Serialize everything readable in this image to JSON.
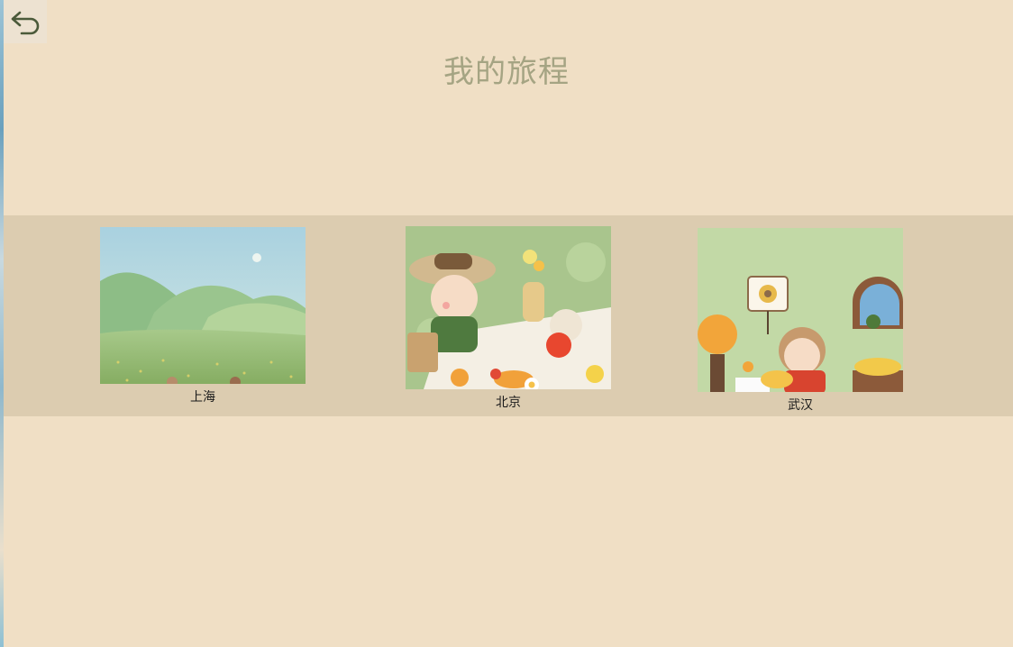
{
  "header": {
    "title": "我的旅程",
    "back_icon": "back-arrow-icon"
  },
  "trips": [
    {
      "city": "上海",
      "scene": "green-hills-meadow"
    },
    {
      "city": "北京",
      "scene": "picnic-bears"
    },
    {
      "city": "武汉",
      "scene": "cozy-room-child"
    }
  ],
  "colors": {
    "page_bg": "#f0dfc5",
    "band_bg": "#dcccb0",
    "title": "#a5a483",
    "icon": "#4b5a3a"
  }
}
